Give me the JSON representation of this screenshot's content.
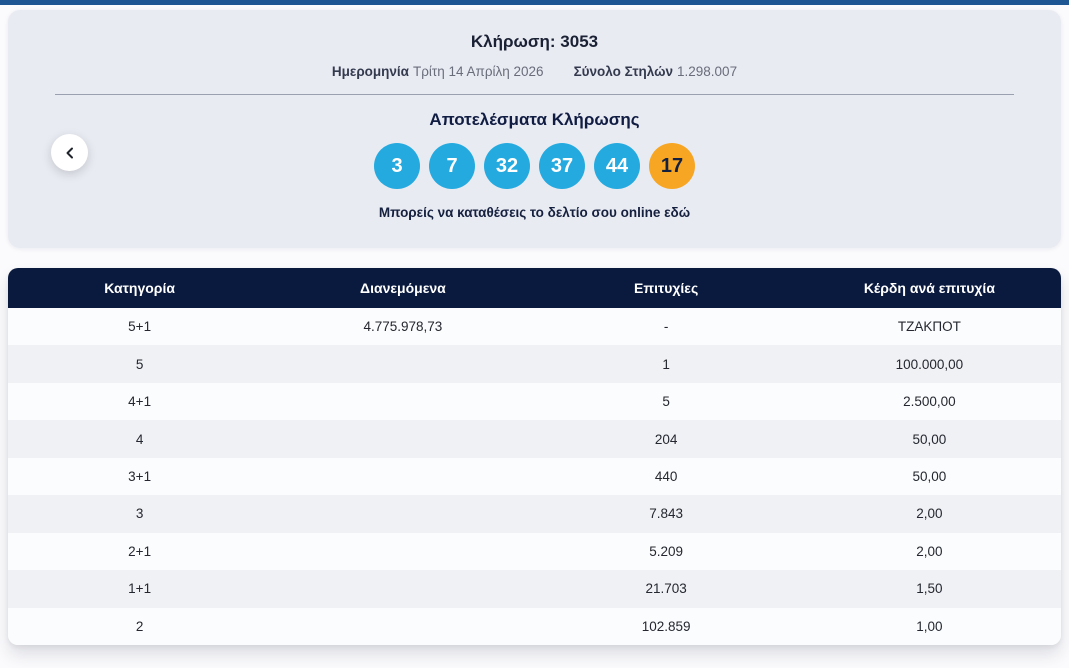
{
  "colors": {
    "top_bar": "#1e5593",
    "panel_bg": "#e9ebf3",
    "ball_blue": "#25aadf",
    "ball_joker": "#f6a623",
    "header_bg": "#0a1a3f"
  },
  "draw_panel": {
    "title": "Κλήρωση: 3053",
    "date_label": "Ημερομηνία",
    "date_value": "Τρίτη 14 Απρίλη 2026",
    "columns_label": "Σύνολο Στηλών",
    "columns_value": "1.298.007",
    "results_title": "Αποτελέσματα Κλήρωσης",
    "numbers": [
      "3",
      "7",
      "32",
      "37",
      "44"
    ],
    "joker_number": "17",
    "deposit_note": "Μπορείς να καταθέσεις το δελτίο σου online εδώ"
  },
  "results_table": {
    "headers": [
      "Κατηγορία",
      "Διανεμόμενα",
      "Επιτυχίες",
      "Κέρδη ανά επιτυχία"
    ],
    "rows": [
      [
        "5+1",
        "4.775.978,73",
        "-",
        "ΤΖΑΚΠΟΤ"
      ],
      [
        "5",
        "",
        "1",
        "100.000,00"
      ],
      [
        "4+1",
        "",
        "5",
        "2.500,00"
      ],
      [
        "4",
        "",
        "204",
        "50,00"
      ],
      [
        "3+1",
        "",
        "440",
        "50,00"
      ],
      [
        "3",
        "",
        "7.843",
        "2,00"
      ],
      [
        "2+1",
        "",
        "5.209",
        "2,00"
      ],
      [
        "1+1",
        "",
        "21.703",
        "1,50"
      ],
      [
        "2",
        "",
        "102.859",
        "1,00"
      ]
    ]
  }
}
